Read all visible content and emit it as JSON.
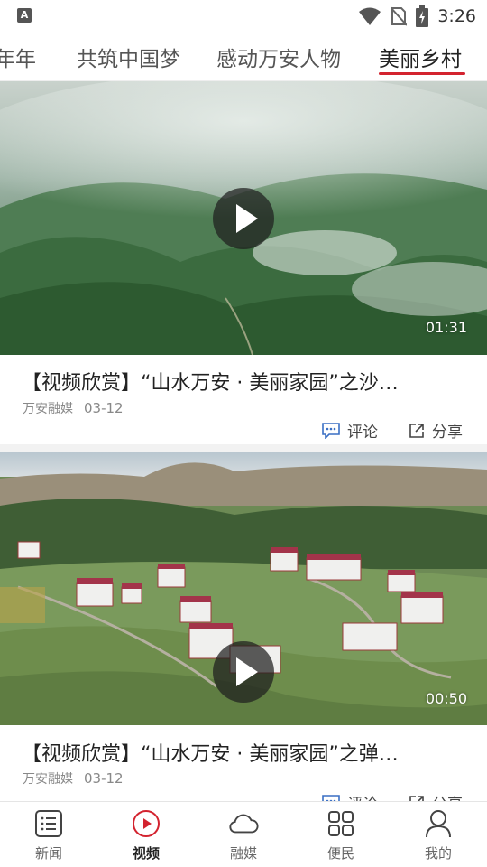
{
  "status_bar": {
    "time": "3:26",
    "left_icon_letter": "A",
    "icons": [
      "wifi-icon",
      "no-sim-icon",
      "battery-icon"
    ]
  },
  "top_tabs": [
    {
      "label": "年年"
    },
    {
      "label": "共筑中国梦"
    },
    {
      "label": "感动万安人物"
    },
    {
      "label": "美丽乡村",
      "active": true
    }
  ],
  "feed": [
    {
      "title": "【视频欣赏】“山水万安 · 美丽家园”之沙…",
      "source": "万安融媒",
      "date": "03-12",
      "duration": "01:31",
      "comment_label": "评论",
      "share_label": "分享"
    },
    {
      "title": "【视频欣赏】“山水万安 · 美丽家园”之弹…",
      "source": "万安融媒",
      "date": "03-12",
      "duration": "00:50",
      "comment_label": "评论",
      "share_label": "分享"
    }
  ],
  "bottom_nav": [
    {
      "label": "新闻",
      "icon": "news-list-icon"
    },
    {
      "label": "视频",
      "icon": "video-play-icon",
      "active": true
    },
    {
      "label": "融媒",
      "icon": "cloud-icon"
    },
    {
      "label": "便民",
      "icon": "grid-apps-icon"
    },
    {
      "label": "我的",
      "icon": "user-icon"
    }
  ],
  "colors": {
    "accent": "#d3232f",
    "comment_icon": "#3a6fc4"
  }
}
